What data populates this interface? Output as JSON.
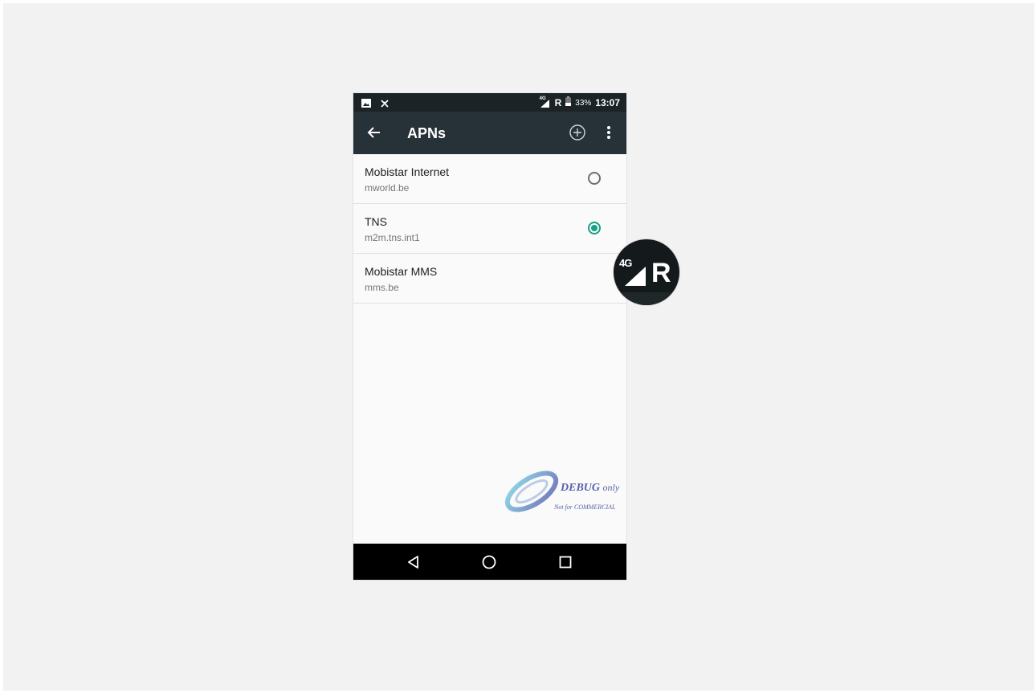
{
  "status_bar": {
    "network": "4G",
    "roaming": "R",
    "battery": "33%",
    "time": "13:07",
    "icons": [
      "image-icon",
      "no-signal-icon",
      "signal-icon",
      "battery-icon"
    ]
  },
  "toolbar": {
    "title": "APNs",
    "icons": [
      "back-arrow-icon",
      "add-circle-icon",
      "more-vert-icon"
    ]
  },
  "apn_list": [
    {
      "name": "Mobistar Internet",
      "apn": "mworld.be",
      "selected": false
    },
    {
      "name": "TNS",
      "apn": "m2m.tns.int1",
      "selected": true
    },
    {
      "name": "Mobistar MMS",
      "apn": "mms.be",
      "selected": null
    }
  ],
  "watermark": {
    "line1": "DEBUG",
    "line1_suffix": "only",
    "line2": "Not for COMMERCIAL"
  },
  "zoom_callout": {
    "network": "4G",
    "roaming": "R"
  },
  "nav_bar": {
    "icons": [
      "back-triangle-icon",
      "home-circle-icon",
      "recents-square-icon"
    ]
  },
  "colors": {
    "status_bar": "#1b2326",
    "toolbar": "#263238",
    "accent": "#16a085",
    "background": "#f2f2f2"
  }
}
